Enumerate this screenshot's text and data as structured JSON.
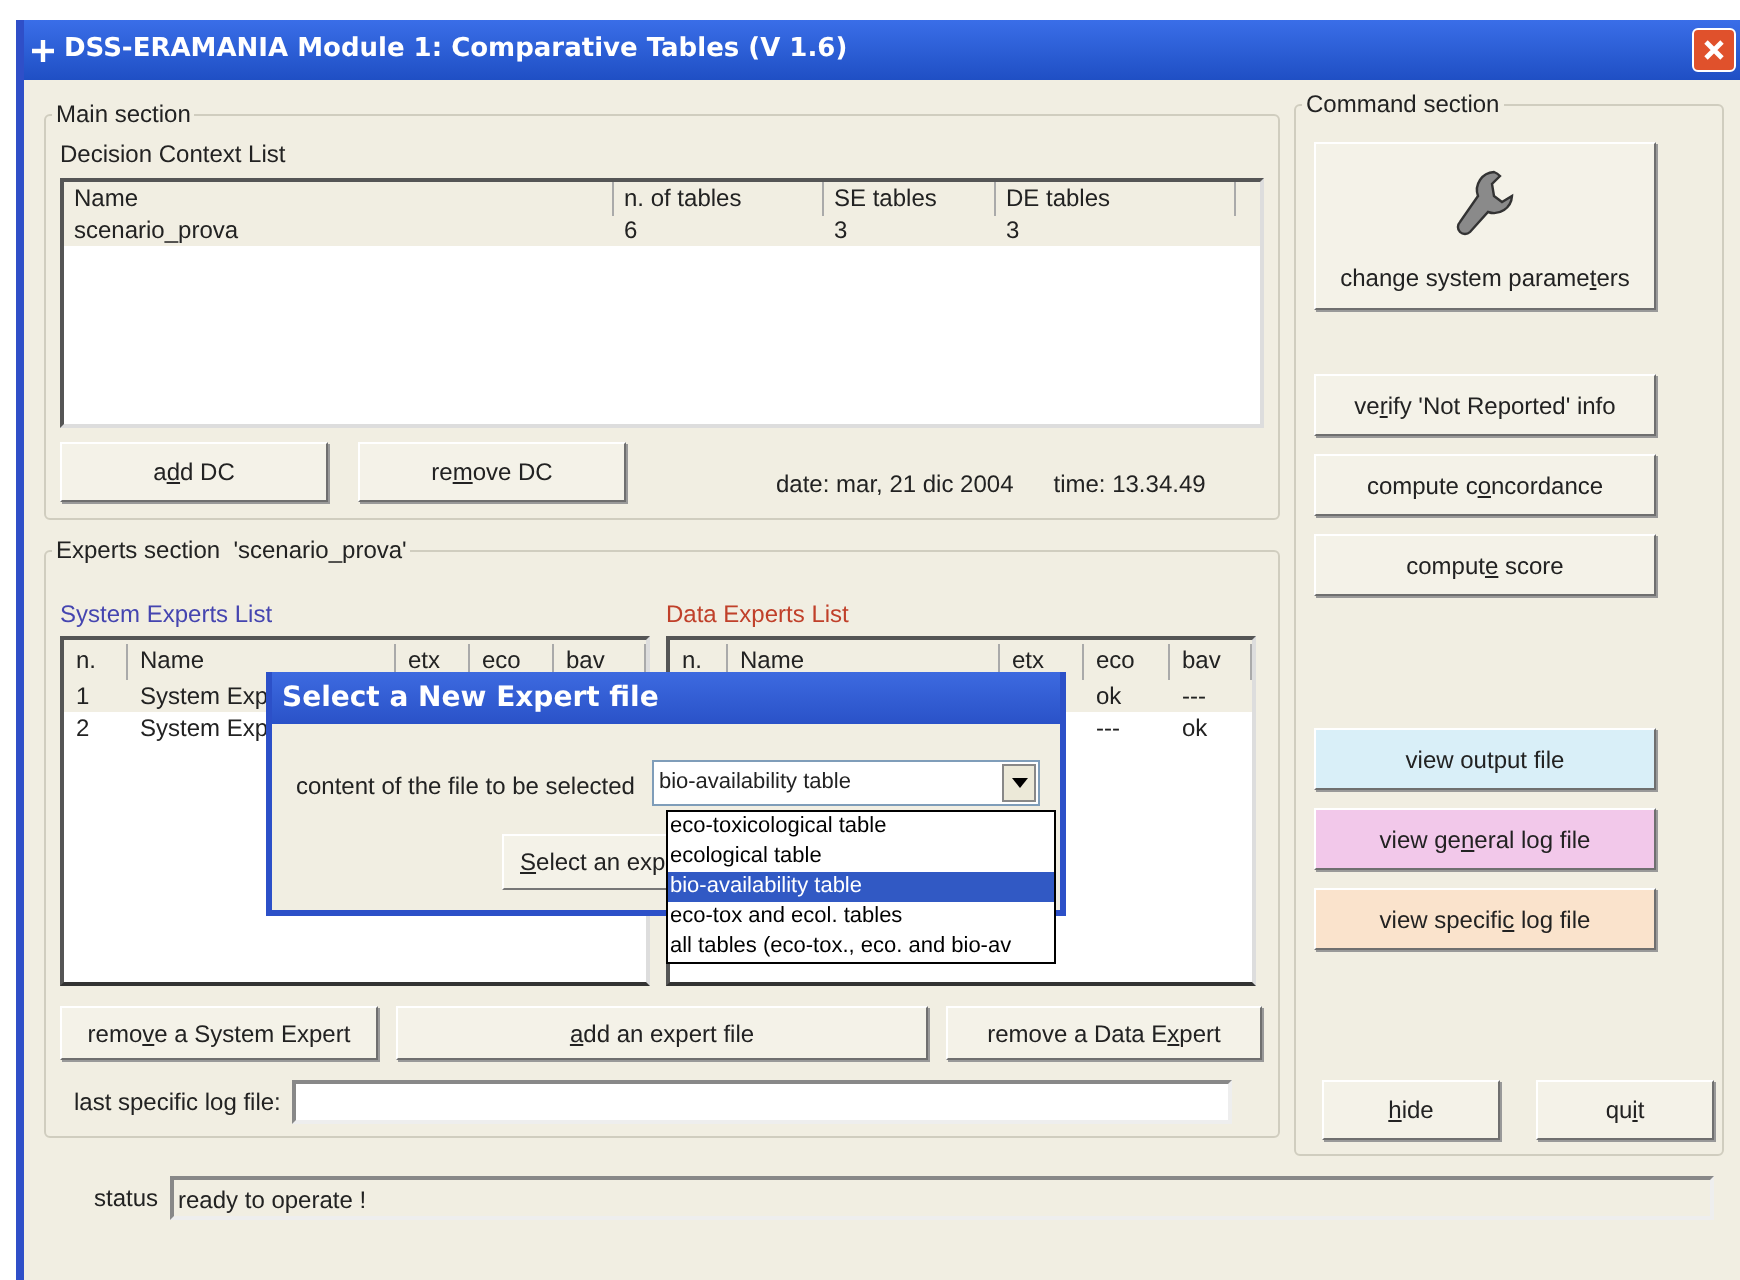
{
  "window": {
    "title": "DSS-ERAMANIA Module 1: Comparative Tables (V 1.6)"
  },
  "main_section": {
    "title": "Main section",
    "list_label": "Decision Context List",
    "columns": [
      "Name",
      "n. of tables",
      "SE tables",
      "DE tables"
    ],
    "rows": [
      [
        "scenario_prova",
        "6",
        "3",
        "3"
      ]
    ],
    "buttons": [
      {
        "label": "add DC"
      },
      {
        "label": "remove DC"
      }
    ],
    "date": "date: mar, 21 dic 2004",
    "time": "time: 13.34.49"
  },
  "experts_section": {
    "title": "Experts section  'scenario_prova'",
    "system_list": {
      "title": "System Experts List",
      "columns": [
        "n.",
        "Name",
        "etx",
        "eco",
        "bav"
      ],
      "rows": [
        {
          "n": "1",
          "name": "System Exp"
        },
        {
          "n": "2",
          "name": "System Exp"
        }
      ]
    },
    "data_list": {
      "title": "Data Experts List",
      "columns": [
        "n.",
        "Name",
        "etx",
        "eco",
        "bav"
      ],
      "rows": [
        {
          "eco": "ok",
          "bav": "---"
        },
        {
          "eco": "---",
          "bav": "ok"
        }
      ]
    },
    "buttons": [
      {
        "label": "remove a System Expert"
      },
      {
        "label": "add an expert file"
      },
      {
        "label": "remove a Data Expert"
      }
    ],
    "last_log_label": "last specific log file:"
  },
  "command_section": {
    "title": "Command section",
    "buttons": [
      {
        "kind": "icon",
        "label": "change system parameters"
      },
      {
        "kind": "plain",
        "label": "verify 'Not Reported' info"
      },
      {
        "kind": "plain",
        "label": "compute concordance"
      },
      {
        "kind": "plain",
        "label": "compute score"
      },
      {
        "kind": "colored",
        "label": "view output file",
        "color": "#d9eff8"
      },
      {
        "kind": "colored",
        "label": "view general log file",
        "color": "#f2c8ea"
      },
      {
        "kind": "colored",
        "label": "view specific log file",
        "color": "#fae3cc"
      }
    ],
    "bottom_buttons": [
      {
        "label": "hide"
      },
      {
        "label": "quit"
      }
    ]
  },
  "status": {
    "label": "status",
    "value": "ready to operate !"
  },
  "dialog": {
    "title": "Select a New Expert file",
    "prompt": "content of the file to be selected",
    "combo_value": "bio-availability table",
    "options": [
      {
        "label": "eco-toxicological table",
        "selected": false
      },
      {
        "label": "ecological table",
        "selected": false
      },
      {
        "label": "bio-availability table",
        "selected": true
      },
      {
        "label": "eco-tox and ecol. tables",
        "selected": false
      },
      {
        "label": "all tables (eco-tox., eco. and bio-av",
        "selected": false
      }
    ],
    "button": {
      "label": "Select an exp"
    }
  }
}
